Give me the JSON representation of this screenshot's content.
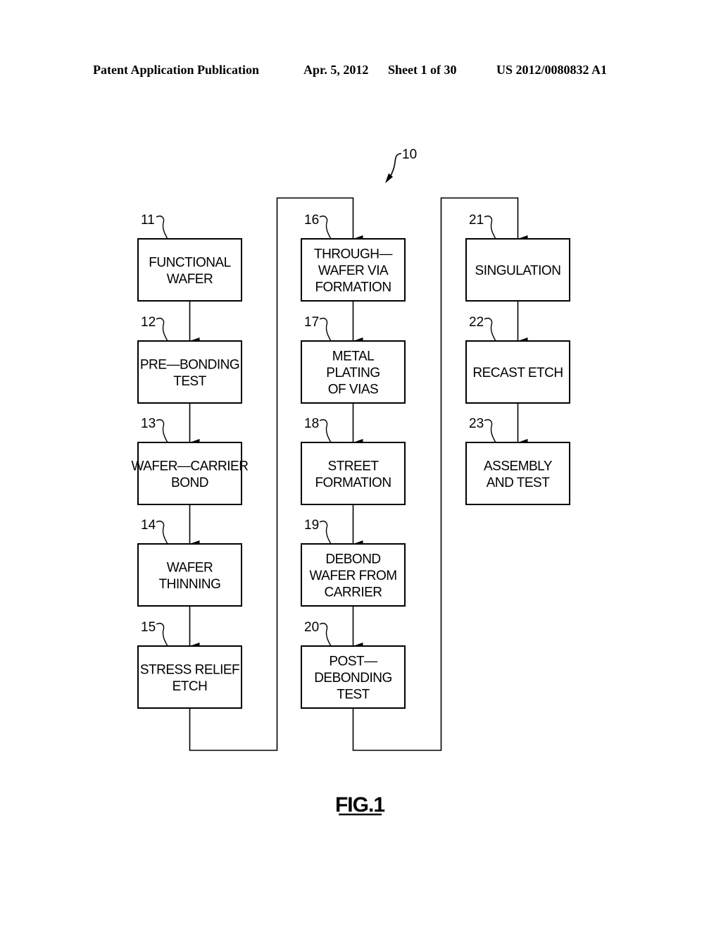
{
  "header": {
    "publication_type": "Patent Application Publication",
    "date": "Apr. 5, 2012",
    "sheet": "Sheet 1 of 30",
    "publication_number": "US 2012/0080832 A1"
  },
  "figure": {
    "label": "FIG.1",
    "reference_numeral": "10"
  },
  "steps": [
    {
      "ref": "11",
      "lines": [
        "FUNCTIONAL",
        "WAFER"
      ]
    },
    {
      "ref": "12",
      "lines": [
        "PRE—BONDING",
        "TEST"
      ]
    },
    {
      "ref": "13",
      "lines": [
        "WAFER—CARRIER",
        "BOND"
      ]
    },
    {
      "ref": "14",
      "lines": [
        "WAFER",
        "THINNING"
      ]
    },
    {
      "ref": "15",
      "lines": [
        "STRESS  RELIEF",
        "ETCH"
      ]
    },
    {
      "ref": "16",
      "lines": [
        "THROUGH—",
        "WAFER  VIA",
        "FORMATION"
      ]
    },
    {
      "ref": "17",
      "lines": [
        "METAL",
        "PLATING",
        "OF  VIAS"
      ]
    },
    {
      "ref": "18",
      "lines": [
        "STREET",
        "FORMATION"
      ]
    },
    {
      "ref": "19",
      "lines": [
        "DEBOND",
        "WAFER  FROM",
        "CARRIER"
      ]
    },
    {
      "ref": "20",
      "lines": [
        "POST—",
        "DEBONDING",
        "TEST"
      ]
    },
    {
      "ref": "21",
      "lines": [
        "SINGULATION"
      ]
    },
    {
      "ref": "22",
      "lines": [
        "RECAST  ETCH"
      ]
    },
    {
      "ref": "23",
      "lines": [
        "ASSEMBLY",
        "AND  TEST"
      ]
    }
  ],
  "flow": [
    [
      "11",
      "12"
    ],
    [
      "12",
      "13"
    ],
    [
      "13",
      "14"
    ],
    [
      "14",
      "15"
    ],
    [
      "15",
      "16"
    ],
    [
      "16",
      "17"
    ],
    [
      "17",
      "18"
    ],
    [
      "18",
      "19"
    ],
    [
      "19",
      "20"
    ],
    [
      "20",
      "21"
    ],
    [
      "21",
      "22"
    ],
    [
      "22",
      "23"
    ]
  ]
}
